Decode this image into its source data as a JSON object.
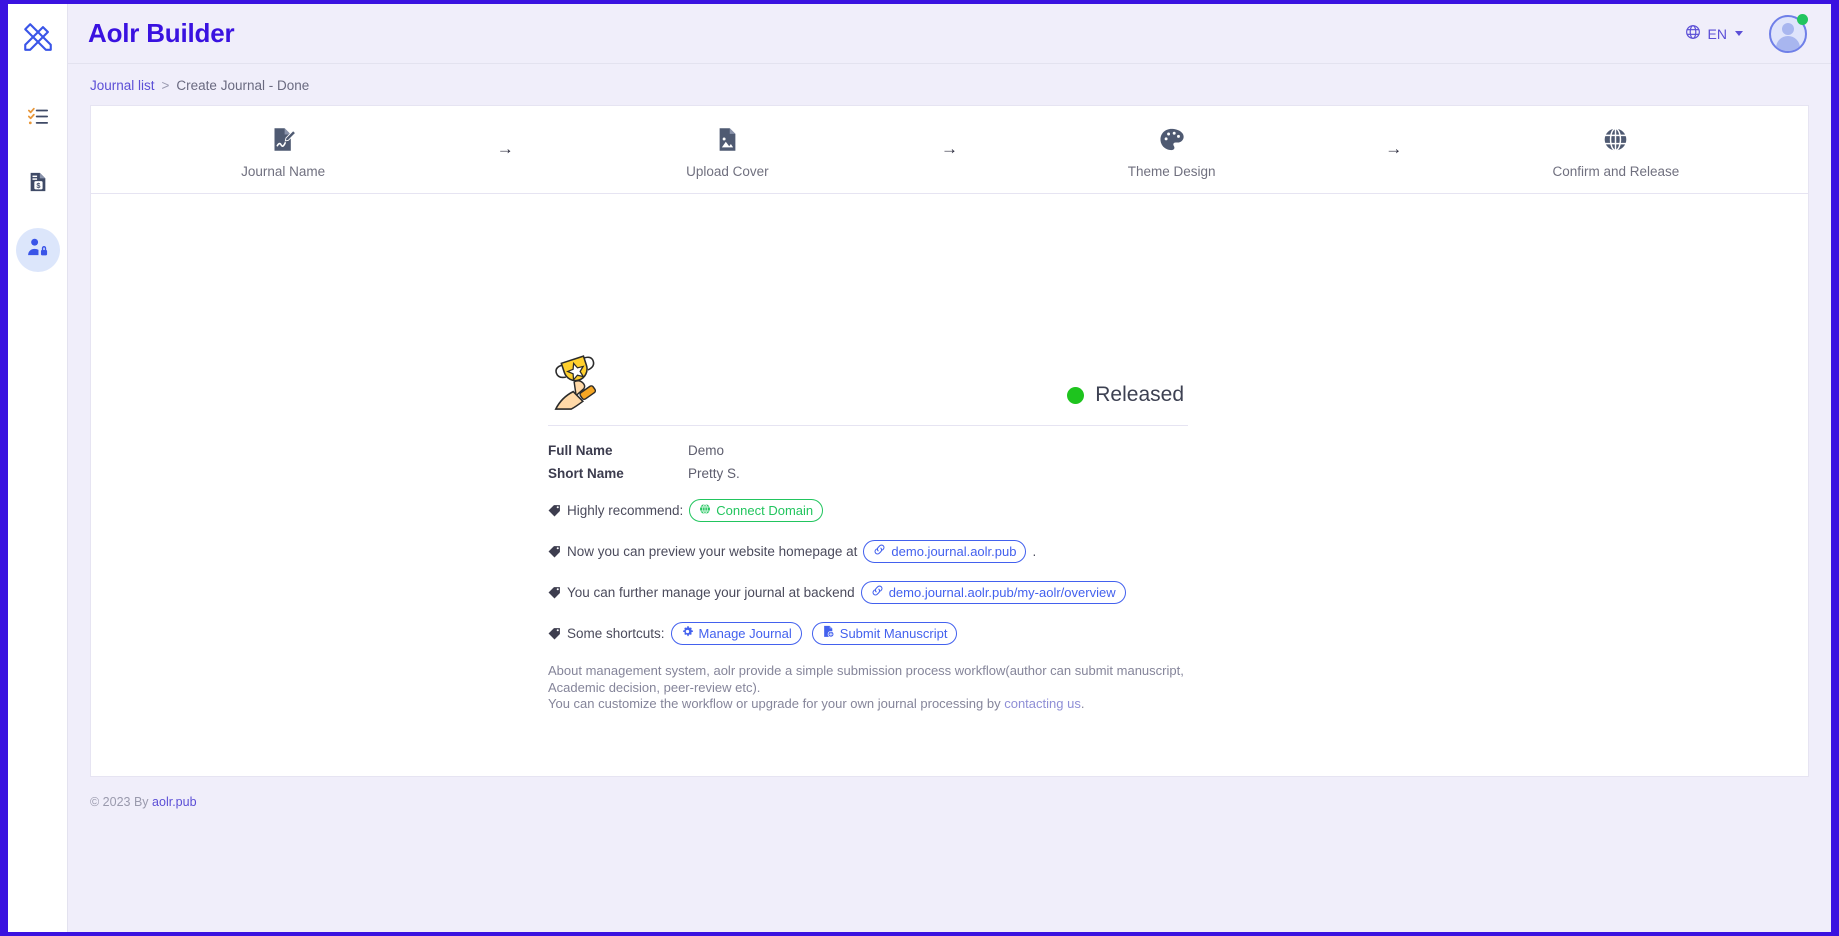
{
  "app": {
    "brand": "Aolr Builder",
    "logo_icon": "crossed-tools-icon"
  },
  "sidebar": {
    "items": [
      {
        "name": "journal-list",
        "icon": "checklist-icon",
        "active": false
      },
      {
        "name": "billing",
        "icon": "invoice-dollar-icon",
        "active": false
      },
      {
        "name": "account",
        "icon": "user-lock-icon",
        "active": true
      }
    ]
  },
  "topbar": {
    "language": {
      "icon": "globe-icon",
      "label": "EN",
      "caret": "chevron-down-icon"
    },
    "avatar": {
      "icon": "avatar-icon",
      "status": "online"
    }
  },
  "breadcrumb": {
    "root": "Journal list",
    "separator": ">",
    "current": "Create Journal - Done"
  },
  "stepper": {
    "arrow": "→",
    "steps": [
      {
        "label": "Journal Name",
        "icon": "document-edit-icon"
      },
      {
        "label": "Upload Cover",
        "icon": "image-file-icon"
      },
      {
        "label": "Theme Design",
        "icon": "palette-icon"
      },
      {
        "label": "Confirm and Release",
        "icon": "globe-grid-icon"
      }
    ]
  },
  "result": {
    "trophy_icon": "trophy-hand-icon",
    "status_label": "Released",
    "status_color": "#1ec41e",
    "details": [
      {
        "key": "Full Name",
        "value": "Demo"
      },
      {
        "key": "Short Name",
        "value": "Pretty S."
      }
    ],
    "notes": [
      {
        "tag_icon": "tag-icon",
        "text": "Highly recommend:",
        "suffix": "",
        "pills": [
          {
            "label": "Connect Domain",
            "icon": "globe-icon",
            "style": "green"
          }
        ]
      },
      {
        "tag_icon": "tag-icon",
        "text": "Now you can preview your website homepage at",
        "suffix": ".",
        "pills": [
          {
            "label": "demo.journal.aolr.pub",
            "icon": "link-icon",
            "style": "blue"
          }
        ]
      },
      {
        "tag_icon": "tag-icon",
        "text": "You can further manage your journal at backend",
        "suffix": "",
        "pills": [
          {
            "label": "demo.journal.aolr.pub/my-aolr/overview",
            "icon": "link-icon",
            "style": "blue"
          }
        ]
      },
      {
        "tag_icon": "tag-icon",
        "text": "Some shortcuts:",
        "suffix": "",
        "pills": [
          {
            "label": "Manage Journal",
            "icon": "gear-icon",
            "style": "blue"
          },
          {
            "label": "Submit Manuscript",
            "icon": "file-plus-icon",
            "style": "blue"
          }
        ]
      }
    ],
    "about": {
      "line1": "About management system, aolr provide a simple submission process workflow(author can submit manuscript,",
      "line2": "Academic decision, peer-review etc).",
      "line3_prefix": "You can customize the workflow or upgrade for your own journal processing by ",
      "line3_link": "contacting us",
      "line3_suffix": "."
    }
  },
  "footer": {
    "copyright": "© 2023 By",
    "link": "aolr.pub"
  }
}
